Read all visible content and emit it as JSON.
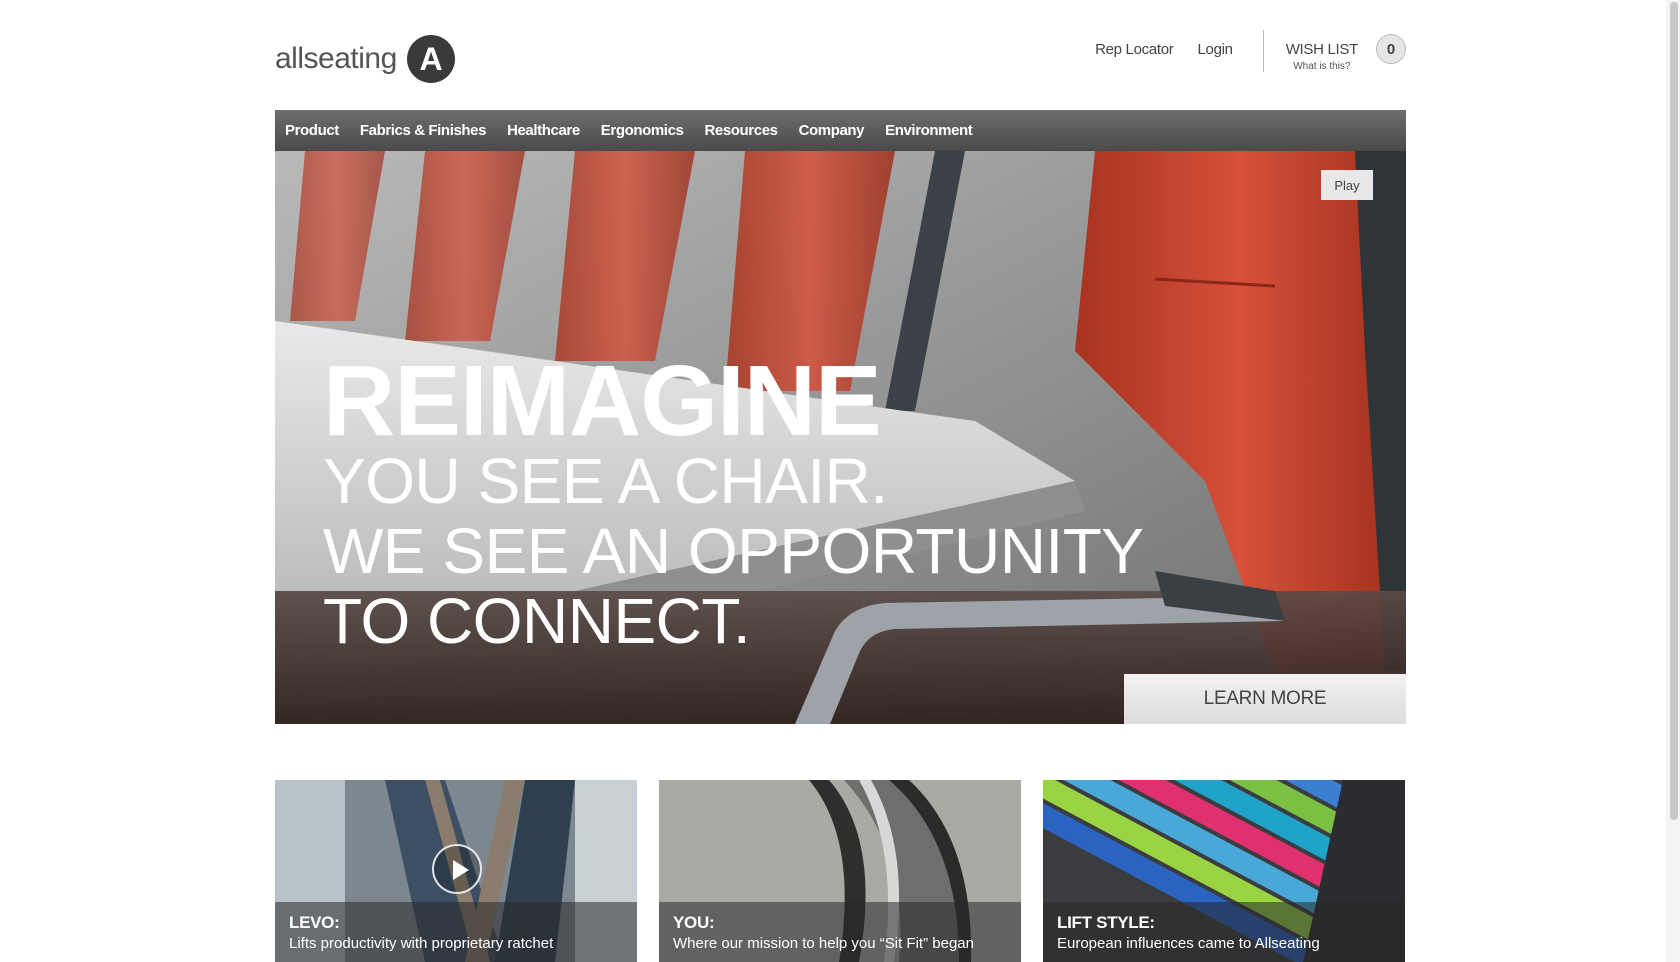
{
  "header": {
    "logo_text": "allseating",
    "logo_mark": "A",
    "rep_locator": "Rep Locator",
    "login": "Login",
    "wishlist_title": "WISH LIST",
    "wishlist_sub": "What is this?",
    "wishlist_count": "0"
  },
  "nav": {
    "items": [
      "Product",
      "Fabrics & Finishes",
      "Healthcare",
      "Ergonomics",
      "Resources",
      "Company",
      "Environment"
    ]
  },
  "hero": {
    "play_label": "Play",
    "title": "REIMAGINE",
    "lines": [
      "YOU SEE A CHAIR.",
      "WE SEE AN OPPORTUNITY",
      "TO CONNECT."
    ],
    "cta": "LEARN MORE"
  },
  "tiles": [
    {
      "title": "LEVO:",
      "desc": "Lifts productivity with proprietary ratchet"
    },
    {
      "title": "YOU:",
      "desc": "Where our mission to help you “Sit Fit” began"
    },
    {
      "title": "LIFT STYLE:",
      "desc": "European influences came to Allseating"
    }
  ],
  "colors": {
    "nav_bg": "#555555",
    "chair_red": "#c9452f",
    "logo_dark": "#3a3a3a"
  }
}
